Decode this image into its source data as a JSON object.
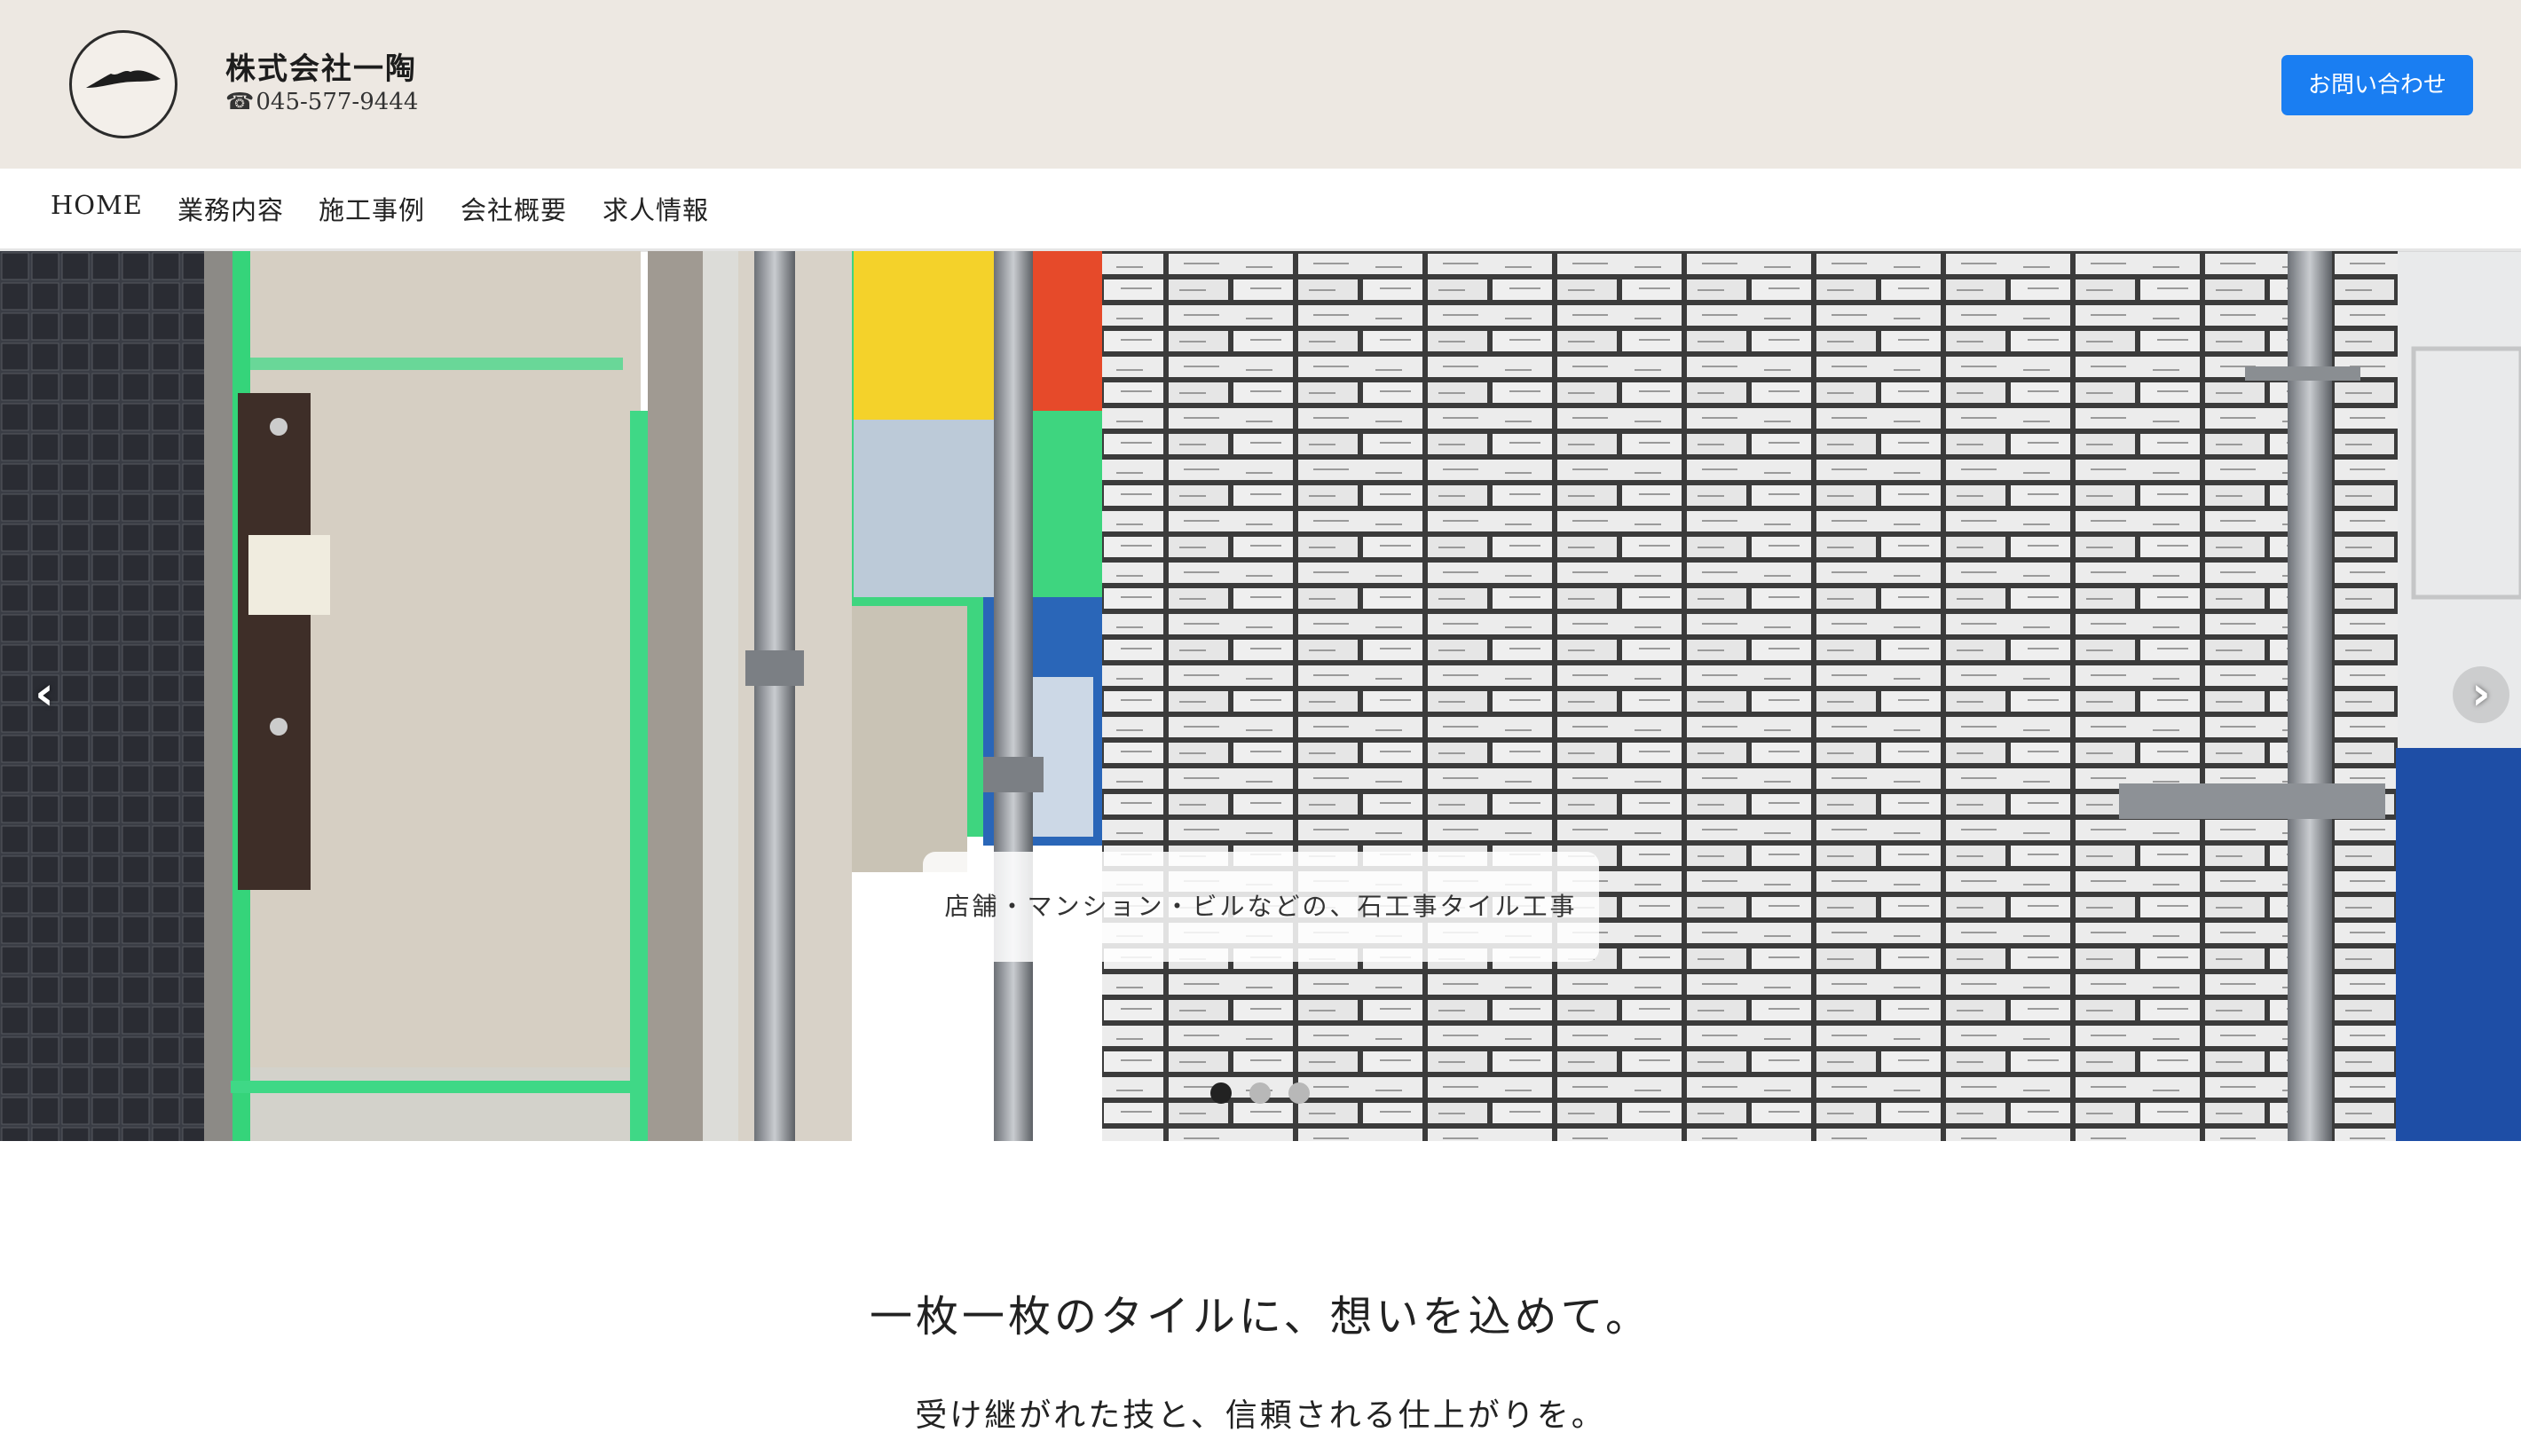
{
  "header": {
    "company_name": "株式会社一陶",
    "phone_icon": "☎",
    "phone": "045-577-9444",
    "contact_button": "お問い合わせ",
    "background_color": "#ede8e2",
    "button_color": "#1a7ef2"
  },
  "nav": {
    "items": [
      {
        "label": "HOME"
      },
      {
        "label": "業務内容"
      },
      {
        "label": "施工事例"
      },
      {
        "label": "会社概要"
      },
      {
        "label": "求人情報"
      }
    ]
  },
  "hero": {
    "caption": "店舗・マンション・ビルなどの、石工事タイル工事",
    "prev_icon": "chevron-left-icon",
    "next_icon": "chevron-right-icon",
    "prev_glyph": "‹",
    "next_glyph": "›",
    "slides_total": 3,
    "active_slide": 1
  },
  "intro": {
    "headline": "一枚一枚のタイルに、想いを込めて。",
    "subline": "受け継がれた技と、信頼される仕上がりを。"
  }
}
